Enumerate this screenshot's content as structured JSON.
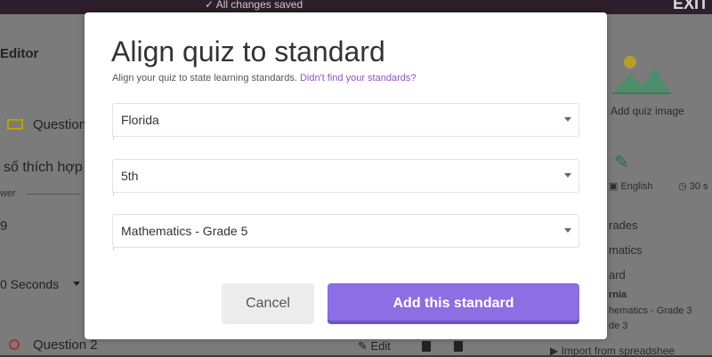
{
  "background": {
    "save_status": "All changes saved",
    "exit_label": "EXIT",
    "editor_label": "Editor",
    "question1_label": "Question",
    "question_text": "số thích hợp",
    "answer_label": "wer",
    "answer_value": "9",
    "time_value": "0 Seconds",
    "question2_label": "Question 2",
    "edit_label": "Edit",
    "add_quiz_image": "Add quiz image",
    "language": "English",
    "time_short": "30 s",
    "grades_label": "rades",
    "subject_label": "matics",
    "standard_label": "ard",
    "state_short": "rnia",
    "standard_short": "hematics - Grade 3",
    "standard_short2": "de 3",
    "import_label": "Import from spreadshee"
  },
  "modal": {
    "title": "Align quiz to standard",
    "subtitle": "Align your quiz to state learning standards.",
    "subtitle_link": "Didn't find your standards?",
    "state_value": "Florida",
    "grade_value": "5th",
    "subject_value": "Mathematics - Grade 5",
    "cancel_label": "Cancel",
    "add_label": "Add this standard"
  },
  "colors": {
    "accent": "#8d6ee3",
    "link": "#8854c0"
  }
}
